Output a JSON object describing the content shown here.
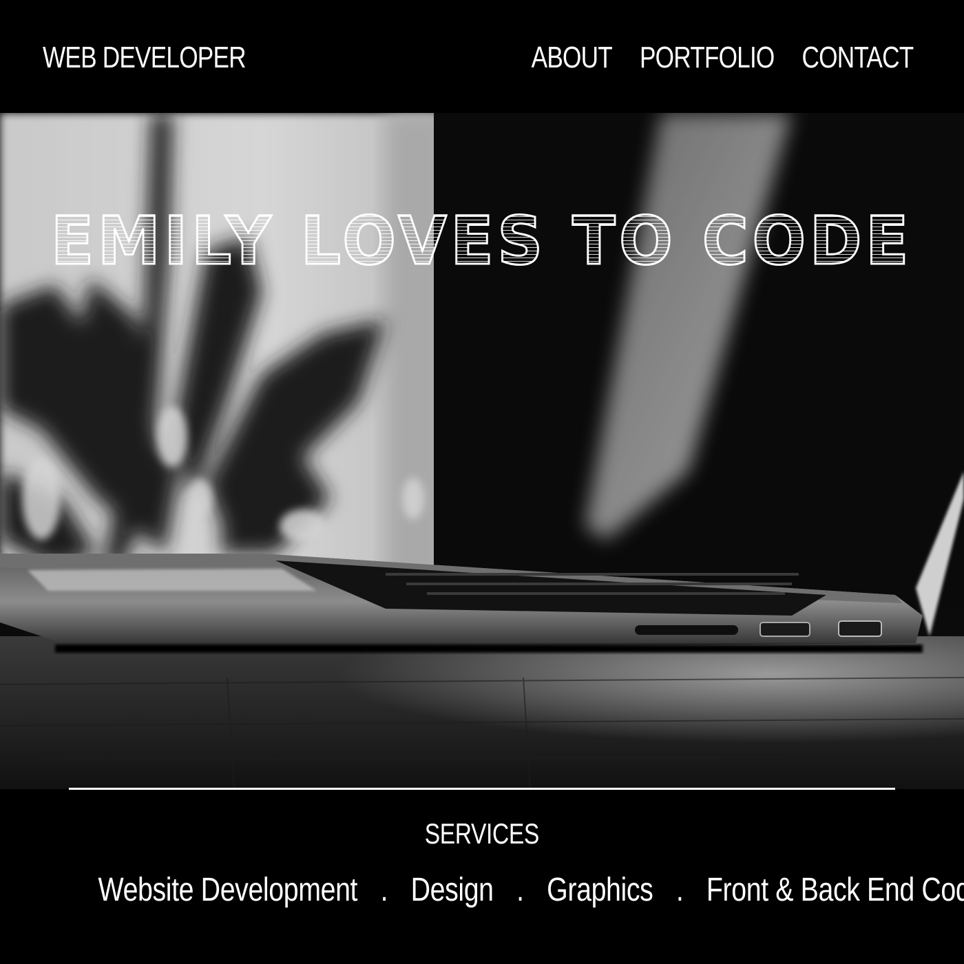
{
  "header": {
    "brand": "WEB DEVELOPER",
    "nav": [
      "ABOUT",
      "PORTFOLIO",
      "CONTACT"
    ]
  },
  "hero": {
    "title": "EMILY LOVES TO CODE",
    "image": "black-and-white photo of laptop beside plant"
  },
  "services": {
    "heading": "SERVICES",
    "items": [
      "Website Development",
      "Design",
      "Graphics",
      "Front & Back End Code."
    ],
    "separator": "."
  },
  "colors": {
    "background": "#000000",
    "text": "#ffffff"
  }
}
